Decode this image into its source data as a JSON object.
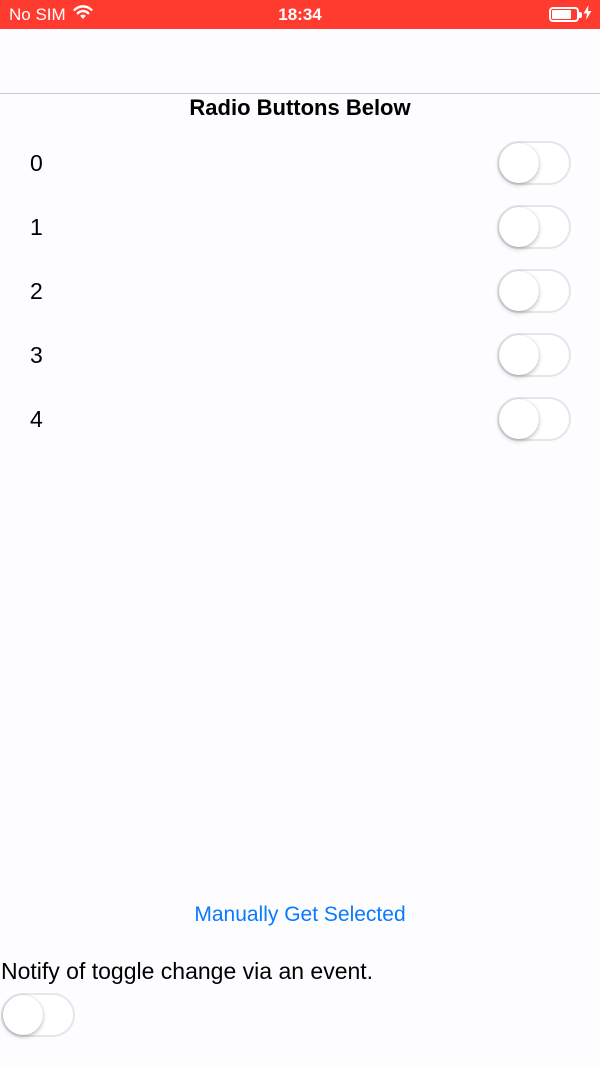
{
  "status_bar": {
    "carrier": "No SIM",
    "time": "18:34",
    "battery_level": 0.85,
    "color": "#ff3b30"
  },
  "title": "Radio Buttons Below",
  "radio_options": [
    {
      "label": "0",
      "on": false
    },
    {
      "label": "1",
      "on": false
    },
    {
      "label": "2",
      "on": false
    },
    {
      "label": "3",
      "on": false
    },
    {
      "label": "4",
      "on": false
    }
  ],
  "manual_button_label": "Manually Get Selected",
  "notify": {
    "label": "Notify of toggle change via an event.",
    "on": false
  },
  "colors": {
    "link": "#0a7aff",
    "switch_off_border": "#e5e5ea"
  }
}
